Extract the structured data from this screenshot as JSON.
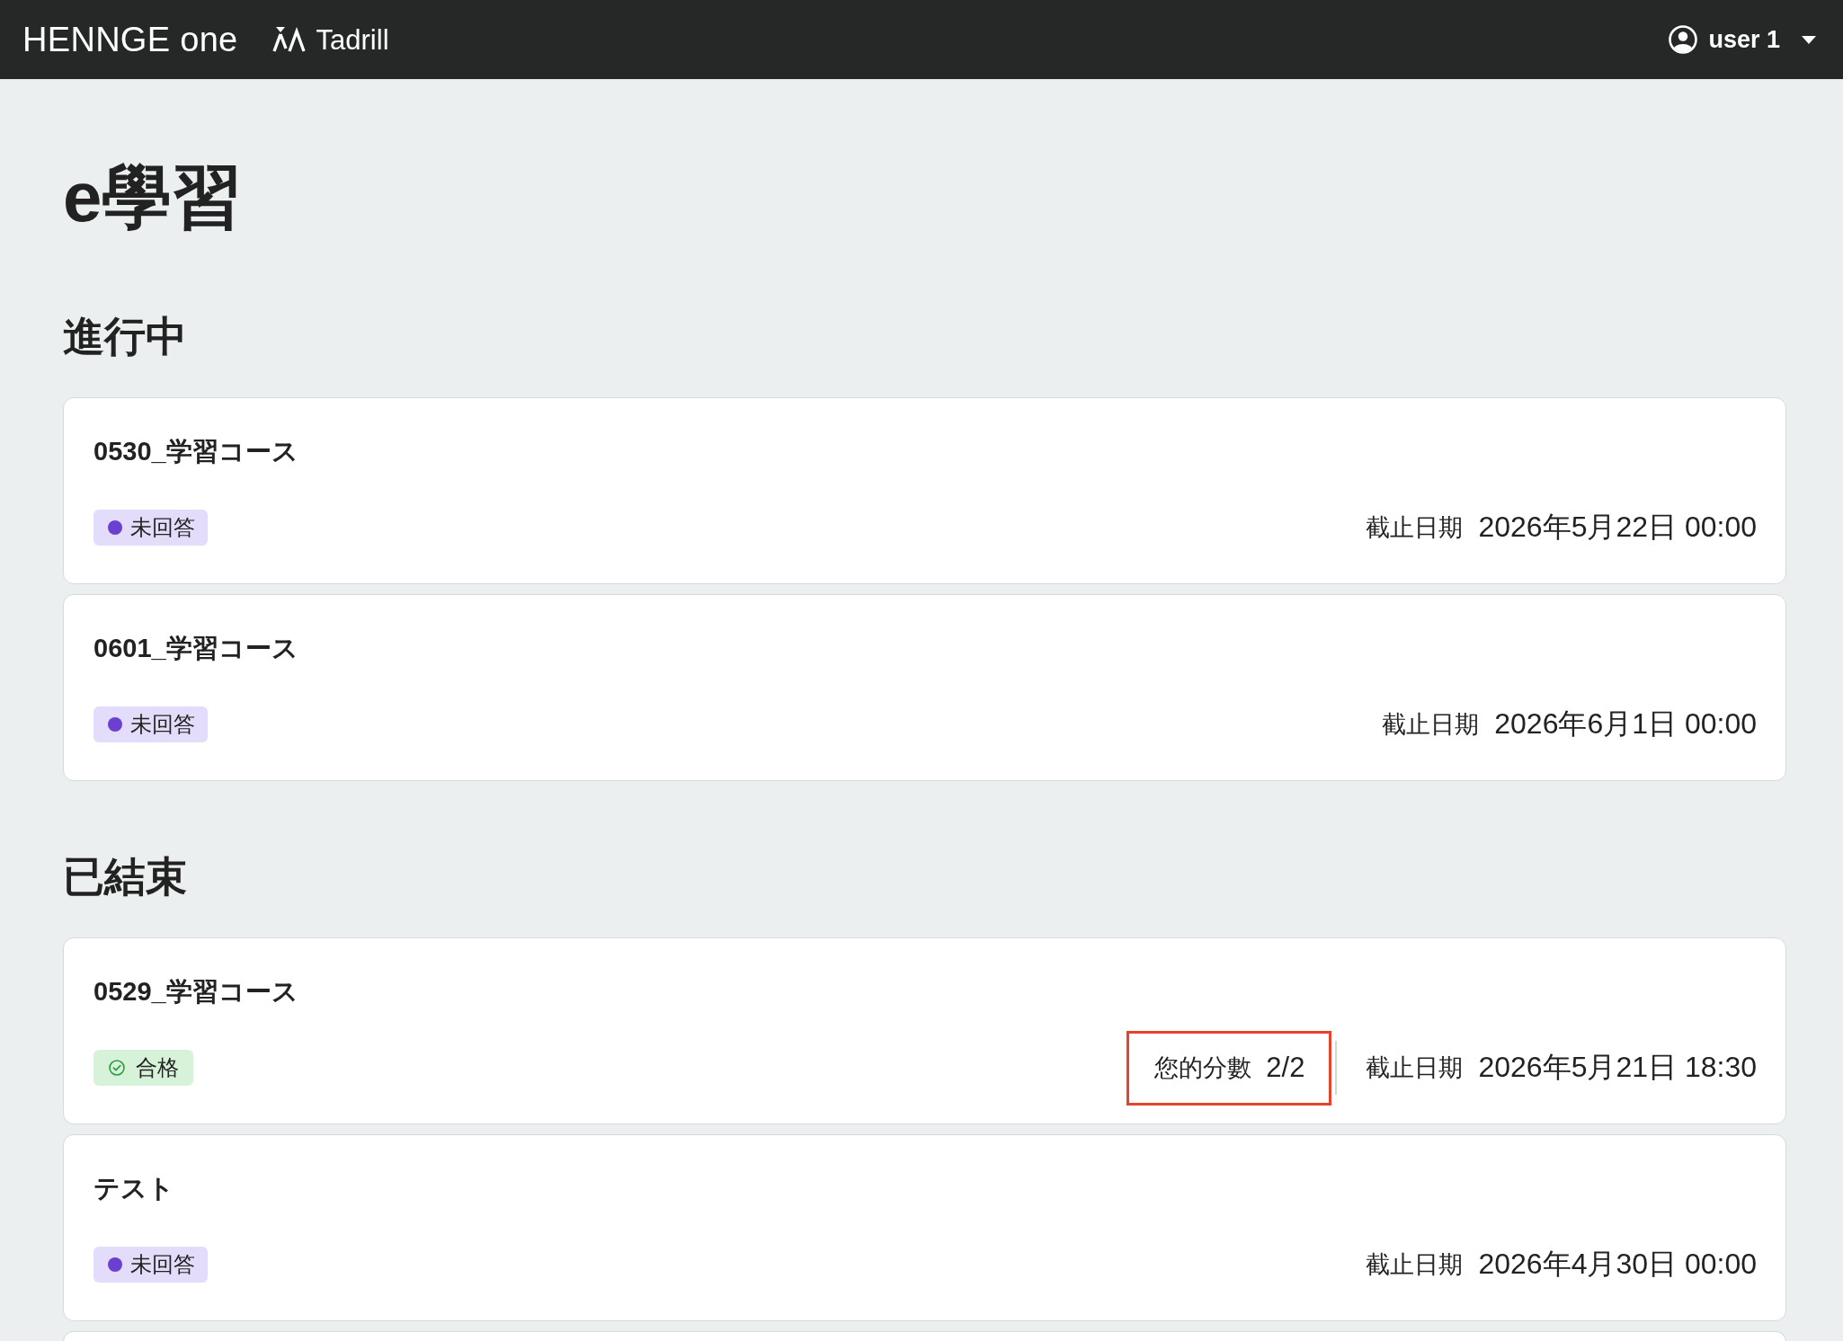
{
  "header": {
    "logo": "HENNGE one",
    "app_name": "Tadrill",
    "user": "user 1"
  },
  "page_title": "e學習",
  "sections": [
    {
      "heading": "進行中",
      "courses": [
        {
          "title": "0530_学習コース",
          "status": {
            "kind": "unanswered",
            "label": "未回答"
          },
          "deadline_label": "截止日期",
          "deadline": "2026年5月22日 00:00"
        },
        {
          "title": "0601_学習コース",
          "status": {
            "kind": "unanswered",
            "label": "未回答"
          },
          "deadline_label": "截止日期",
          "deadline": "2026年6月1日 00:00"
        }
      ]
    },
    {
      "heading": "已結束",
      "courses": [
        {
          "title": "0529_学習コース",
          "status": {
            "kind": "passed",
            "label": "合格"
          },
          "score": {
            "label": "您的分數",
            "value": "2/2",
            "highlighted": true
          },
          "deadline_label": "截止日期",
          "deadline": "2026年5月21日 18:30"
        },
        {
          "title": "テスト",
          "status": {
            "kind": "unanswered",
            "label": "未回答"
          },
          "deadline_label": "截止日期",
          "deadline": "2026年4月30日 00:00"
        }
      ]
    }
  ]
}
